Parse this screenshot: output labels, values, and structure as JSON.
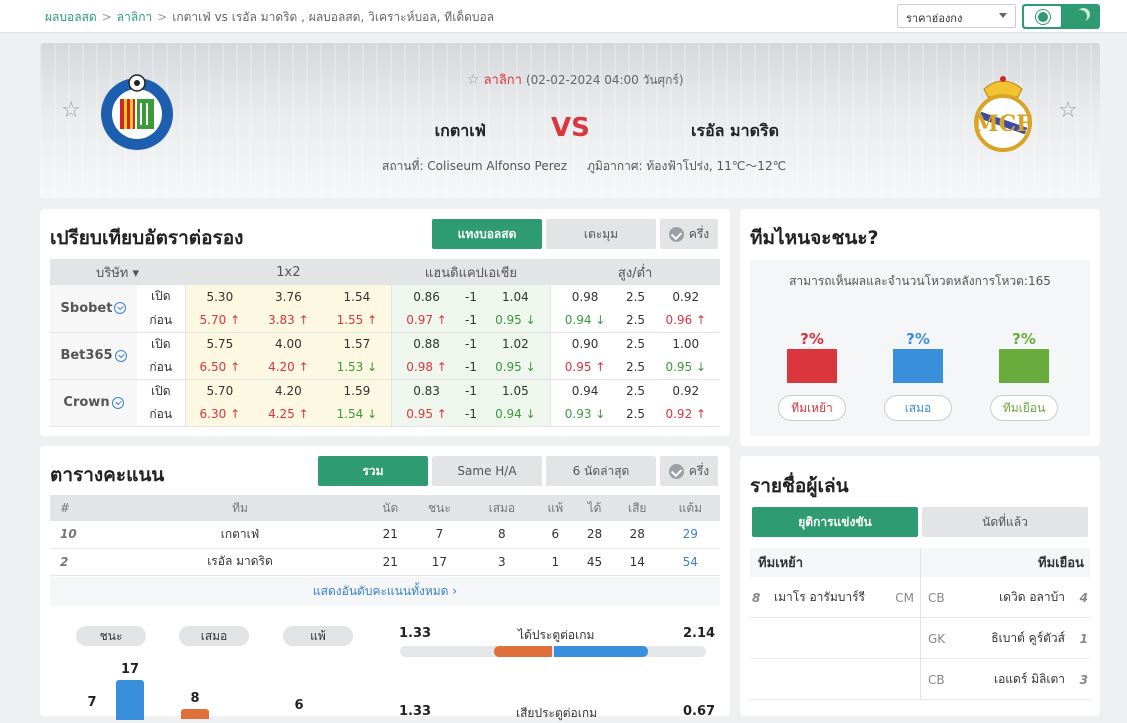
{
  "breadcrumb": [
    "ผลบอลสด",
    "ลาลิกา",
    "เกตาเฟ่ vs  เรอัล มาดริด ,  ผลบอลสด,  วิเคราะห์บอล,  ทีเด็ดบอล"
  ],
  "odds_select": "ราคาฮ่องกง",
  "match": {
    "league": "ลาลิกา",
    "datetime": "(02-02-2024 04:00 วันศุกร์)",
    "home": "เกตาเฟ่",
    "vs": "VS",
    "away": "เรอัล มาดริด",
    "venue": "สถานที่: Coliseum Alfonso Perez",
    "weather": "ภูมิอากาศ: ท้องฟ้าโปร่ง, 11℃～12℃"
  },
  "odds": {
    "title": "เปรียบเทียบอัตราต่อรอง",
    "tabs": [
      "แทงบอลสด",
      "เตะมุม"
    ],
    "half_label": "ครึ่ง",
    "headers": [
      "บริษัท",
      "1x2",
      "แฮนดิแคปเอเชีย",
      "สูง/ต่ำ"
    ],
    "rows": [
      {
        "book": "Sbobet",
        "open": [
          "5.30",
          "3.76",
          "1.54",
          "0.86",
          "-1",
          "1.04",
          "0.98",
          "2.5",
          "0.92"
        ],
        "live": [
          "5.70 ↑",
          "3.83 ↑",
          "1.55 ↑",
          "0.97 ↑",
          "-1",
          "0.95 ↓",
          "0.94 ↓",
          "2.5",
          "0.96 ↑"
        ]
      },
      {
        "book": "Bet365",
        "open": [
          "5.75",
          "4.00",
          "1.57",
          "0.88",
          "-1",
          "1.02",
          "0.90",
          "2.5",
          "1.00"
        ],
        "live": [
          "6.50 ↑",
          "4.20 ↑",
          "1.53 ↓",
          "0.98 ↑",
          "-1",
          "0.95 ↓",
          "0.95 ↑",
          "2.5",
          "0.95 ↓"
        ]
      },
      {
        "book": "Crown",
        "open": [
          "5.70",
          "4.20",
          "1.59",
          "0.83",
          "-1",
          "1.05",
          "0.94",
          "2.5",
          "0.92"
        ],
        "live": [
          "6.30 ↑",
          "4.25 ↑",
          "1.54 ↓",
          "0.95 ↑",
          "-1",
          "0.94 ↓",
          "0.93 ↓",
          "2.5",
          "0.92 ↑"
        ]
      }
    ],
    "open_label": "เปิด",
    "live_label": "ก่อน"
  },
  "standings": {
    "title": "ตารางคะแนน",
    "tabs": [
      "รวม",
      "Same H/A",
      "6 นัดล่าสุด"
    ],
    "half_label": "ครึ่ง",
    "headers": [
      "#",
      "ทีม",
      "นัด",
      "ชนะ",
      "เสมอ",
      "แพ้",
      "ได้",
      "เสีย",
      "แต้ม"
    ],
    "rows": [
      [
        "10",
        "เกตาเฟ่",
        "21",
        "7",
        "8",
        "6",
        "28",
        "28",
        "29"
      ],
      [
        "2",
        "เรอัล มาดริด",
        "21",
        "17",
        "3",
        "1",
        "45",
        "14",
        "54"
      ]
    ],
    "show_all": "แสดงอันดับคะแนนทั้งหมด ›"
  },
  "record": {
    "pills": [
      "ชนะ",
      "เสมอ",
      "แพ้"
    ],
    "bars": [
      {
        "value": "7",
        "color": "#3a8fdb"
      },
      {
        "value": "17",
        "color": "#3a8fdb"
      },
      {
        "value": "8",
        "color": "#e0703a"
      },
      {
        "value": "6",
        "color": "#3a8fdb"
      }
    ],
    "goals_label": "ได้ประตูต่อเกม",
    "home_goals": "1.33",
    "away_goals": "2.14",
    "conceded_label": "เสียประตูต่อเกม",
    "home_conceded": "1.33",
    "away_conceded": "0.67",
    "colors": {
      "home": "#e0703a",
      "away": "#3a8fdb"
    }
  },
  "vote": {
    "title": "ทีมไหนจะชนะ?",
    "note": "สามารถเห็นผลและจำนวนโหวตหลังการโหวต:165",
    "options": [
      {
        "pct": "?%",
        "label": "ทีมเหย้า",
        "color": "#d9363e"
      },
      {
        "pct": "?%",
        "label": "เสมอ",
        "color": "#3a8fdb"
      },
      {
        "pct": "?%",
        "label": "ทีมเยือน",
        "color": "#6aab3e"
      }
    ]
  },
  "lineup": {
    "title": "รายชื่อผู้เล่น",
    "tabs": [
      "ยุติการแข่งขัน",
      "นัดที่แล้ว"
    ],
    "home_label": "ทีมเหย้า",
    "away_label": "ทีมเยือน",
    "home": [
      {
        "num": "8",
        "name": "เมาโร อารัมบาร์รี",
        "pos": "CM"
      }
    ],
    "away": [
      {
        "pos": "CB",
        "name": "เดวิด อลาบ้า",
        "num": "4"
      },
      {
        "pos": "GK",
        "name": "ธิเบาต์ คูร์ตัวส์",
        "num": "1"
      },
      {
        "pos": "CB",
        "name": "เอแดร์ มิลิเตา",
        "num": "3"
      }
    ]
  }
}
